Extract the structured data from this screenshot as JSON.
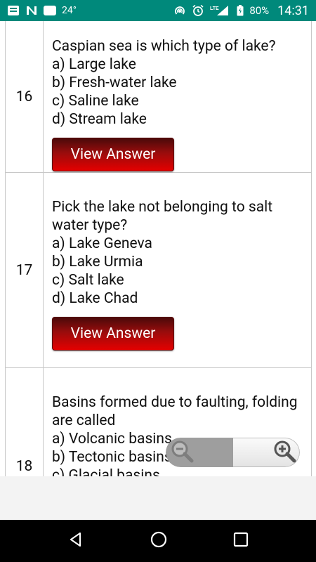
{
  "status_bar": {
    "temperature": "24°",
    "network_type": "LTE",
    "battery": "80%",
    "time": "14:31",
    "icons": [
      "notes-icon",
      "n-app-icon",
      "app-box-icon",
      "hotspot-icon",
      "alarm-icon",
      "signal-icon",
      "battery-icon"
    ]
  },
  "questions": [
    {
      "number": "16",
      "text": "Caspian sea is which type of lake?",
      "options": [
        "a) Large lake",
        "b) Fresh-water lake",
        "c) Saline lake",
        "d) Stream lake"
      ],
      "button": "View Answer"
    },
    {
      "number": "17",
      "text": "Pick the lake not belonging to salt water type?",
      "options": [
        "a) Lake Geneva",
        "b) Lake Urmia",
        "c) Salt lake",
        "d) Lake Chad"
      ],
      "button": "View Answer"
    },
    {
      "number": "18",
      "text": "Basins formed due to faulting, folding are called",
      "options": [
        "a) Volcanic basins",
        "b) Tectonic basins",
        "c) Glacial basins"
      ],
      "button": ""
    }
  ],
  "zoom_control": {
    "zoom_out_icon": "zoom-out-icon",
    "zoom_in_icon": "zoom-in-icon"
  },
  "navigation": {
    "back_icon": "back-icon",
    "home_icon": "home-icon",
    "recents_icon": "recents-icon"
  }
}
